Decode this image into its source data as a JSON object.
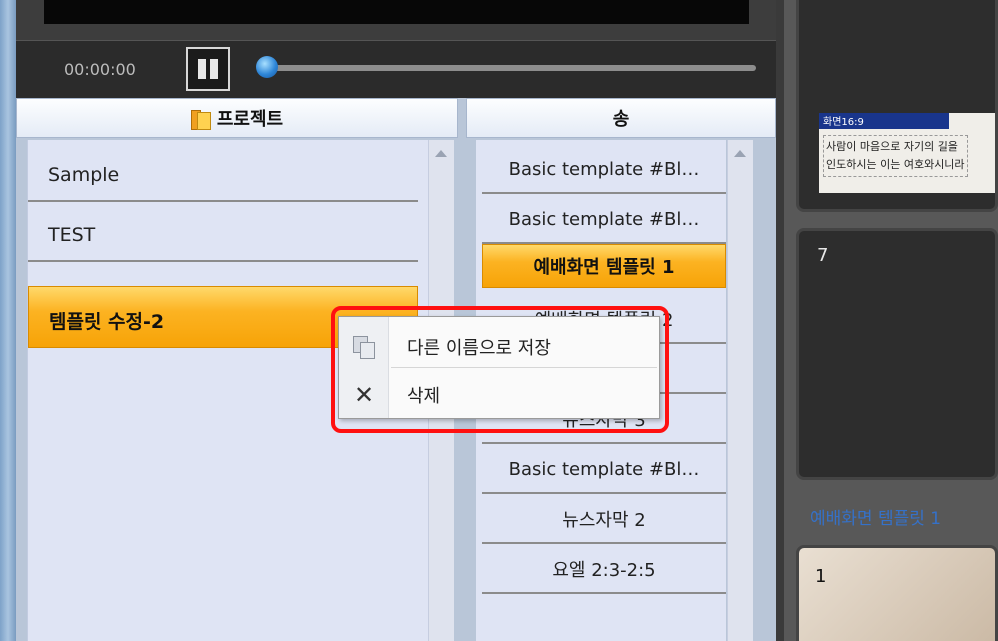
{
  "player": {
    "time": "00:00:00",
    "progress": 0
  },
  "projects": {
    "header": "프로젝트",
    "items": [
      {
        "label": "Sample"
      },
      {
        "label": "TEST"
      },
      {
        "label": "템플릿 수정-2"
      }
    ],
    "selected_index": 2
  },
  "songs": {
    "header": "송",
    "items": [
      {
        "label": "Basic template #Bl…"
      },
      {
        "label": "Basic template #Bl…"
      },
      {
        "label": "예배화면 템플릿 1"
      },
      {
        "label": "예배화면 템플릿 2"
      },
      {
        "label": ""
      },
      {
        "label": "뉴스자막 3"
      },
      {
        "label": "Basic template #Bl…"
      },
      {
        "label": "뉴스자막 2"
      },
      {
        "label": "요엘 2:3-2:5"
      }
    ],
    "selected_index": 2
  },
  "context_menu": {
    "items": [
      {
        "label": "다른 이름으로 저장",
        "icon": "copy-icon"
      },
      {
        "label": "삭제",
        "icon": "delete-icon"
      }
    ]
  },
  "thumbnails": {
    "first": {
      "badge": "화면16:9",
      "line1": "사람이 마음으로 자기의 길을",
      "line2": "인도하시는 이는 여호와시니라"
    },
    "second_number": "7",
    "second_label": "예배화면 템플릿 1",
    "third_number": "1"
  },
  "colors": {
    "selection": "#fcb322",
    "highlight": "#ff1010",
    "link": "#3571c8"
  }
}
